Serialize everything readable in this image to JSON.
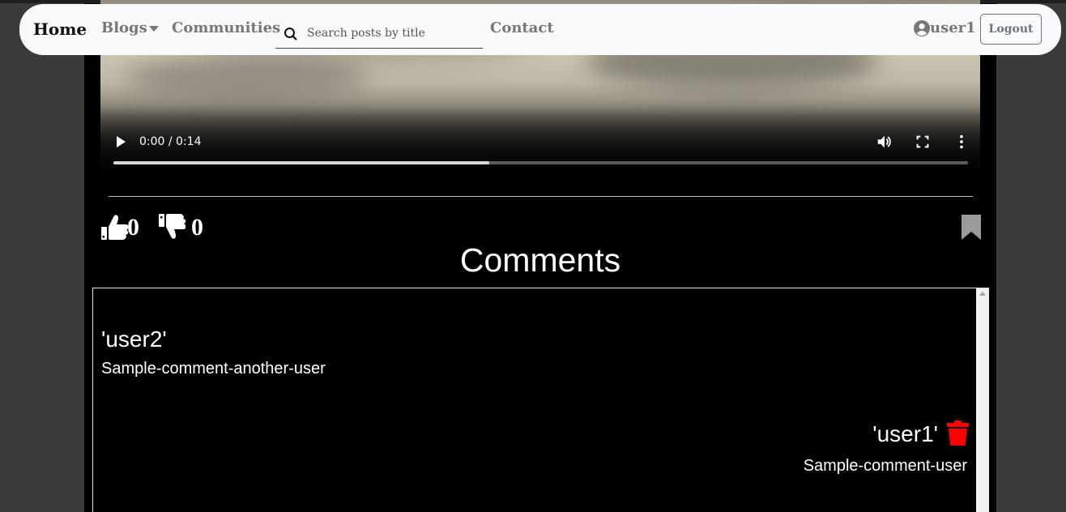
{
  "navbar": {
    "brand": "Home",
    "links": {
      "blogs": "Blogs",
      "communities": "Communities",
      "contact": "Contact"
    },
    "search": {
      "placeholder": "Search posts by title",
      "value": ""
    },
    "user": "user1",
    "logout": "Logout"
  },
  "video": {
    "time": "0:00 / 0:14",
    "buffered_fraction": 0.44
  },
  "reactions": {
    "likes": "0",
    "dislikes": "0"
  },
  "comments": {
    "title": "Comments",
    "items": [
      {
        "user": "'user2'",
        "text": "Sample-comment-another-user"
      },
      {
        "user": "'user1'",
        "text": "Sample-comment-user"
      }
    ]
  },
  "colors": {
    "navbar_bg": "#f8f9fa",
    "page_bg": "#000000",
    "delete": "#ff0000",
    "bookmark": "#9a9a9a"
  },
  "icons": [
    "play-icon",
    "volume-icon",
    "fullscreen-icon",
    "more-vert-icon",
    "thumbs-up-icon",
    "thumbs-down-icon",
    "bookmark-icon",
    "trash-icon",
    "search-icon",
    "user-circle-icon"
  ]
}
